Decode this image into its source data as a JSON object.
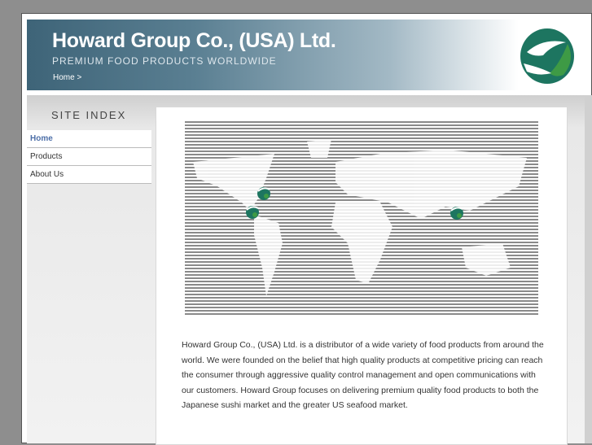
{
  "header": {
    "title": "Howard Group Co., (USA) Ltd.",
    "tagline": "PREMIUM FOOD PRODUCTS WORLDWIDE",
    "breadcrumb": "Home >"
  },
  "sidebar": {
    "heading": "SITE INDEX",
    "items": [
      {
        "label": "Home"
      },
      {
        "label": "Products"
      },
      {
        "label": "About Us"
      }
    ]
  },
  "main": {
    "paragraph": "Howard Group Co., (USA) Ltd. is a distributor of a wide variety of food products from around the world. We were founded on the belief that high quality products at competitive pricing can reach the consumer through aggressive quality control management and open communications with our customers. Howard Group focuses on delivering premium quality food products to both the Japanese sushi market and the greater US seafood market."
  },
  "colors": {
    "accent": "#4d6fa8",
    "logo_teal": "#1d7560",
    "logo_green": "#3e9a45"
  }
}
